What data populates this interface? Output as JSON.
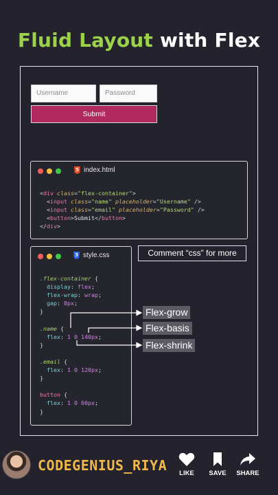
{
  "title": {
    "part1": "Fluid Layout",
    "part2": "with Flex"
  },
  "demo_form": {
    "username_placeholder": "Username",
    "password_placeholder": "Password",
    "submit_label": "Submit"
  },
  "html_panel": {
    "filename": "index.html",
    "icon": "html5-icon",
    "code": {
      "l1_tag_open": "<div",
      "l1_attr": "class",
      "l1_val": "\"flex-container\"",
      "l2_attr2": "placeholder",
      "l2_class": "\"name\"",
      "l2_ph": "\"Username\"",
      "l3_class": "\"email\"",
      "l3_ph": "\"Password\"",
      "l4_text": "Submit"
    }
  },
  "css_panel": {
    "filename": "style.css",
    "icon": "css3-icon"
  },
  "comment_box": "Comment “css” for more",
  "annotations": {
    "grow": "Flex-grow",
    "basis": "Flex-basis",
    "shrink": "Flex-shrink"
  },
  "footer": {
    "username": "CODEGENIUS_RIYA",
    "like_label": "LIKE",
    "save_label": "SAVE",
    "share_label": "SHARE"
  },
  "colors": {
    "background": "#23222d",
    "title_green": "#9bd24a",
    "submit": "#b02a5d",
    "username": "#f0b948"
  }
}
